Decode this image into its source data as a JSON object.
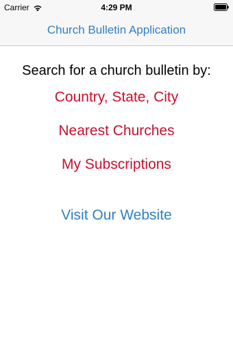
{
  "status_bar": {
    "carrier": "Carrier",
    "time": "4:29 PM",
    "wifi_icon": "wifi-icon",
    "battery_icon": "battery-icon"
  },
  "nav": {
    "title": "Church Bulletin Application"
  },
  "main": {
    "prompt": "Search for a church bulletin by:",
    "options": [
      {
        "label": "Country, State, City"
      },
      {
        "label": "Nearest Churches"
      },
      {
        "label": "My Subscriptions"
      }
    ],
    "website_link": "Visit Our Website"
  },
  "colors": {
    "link_red": "#c8102e",
    "link_blue": "#2f7fc5"
  }
}
